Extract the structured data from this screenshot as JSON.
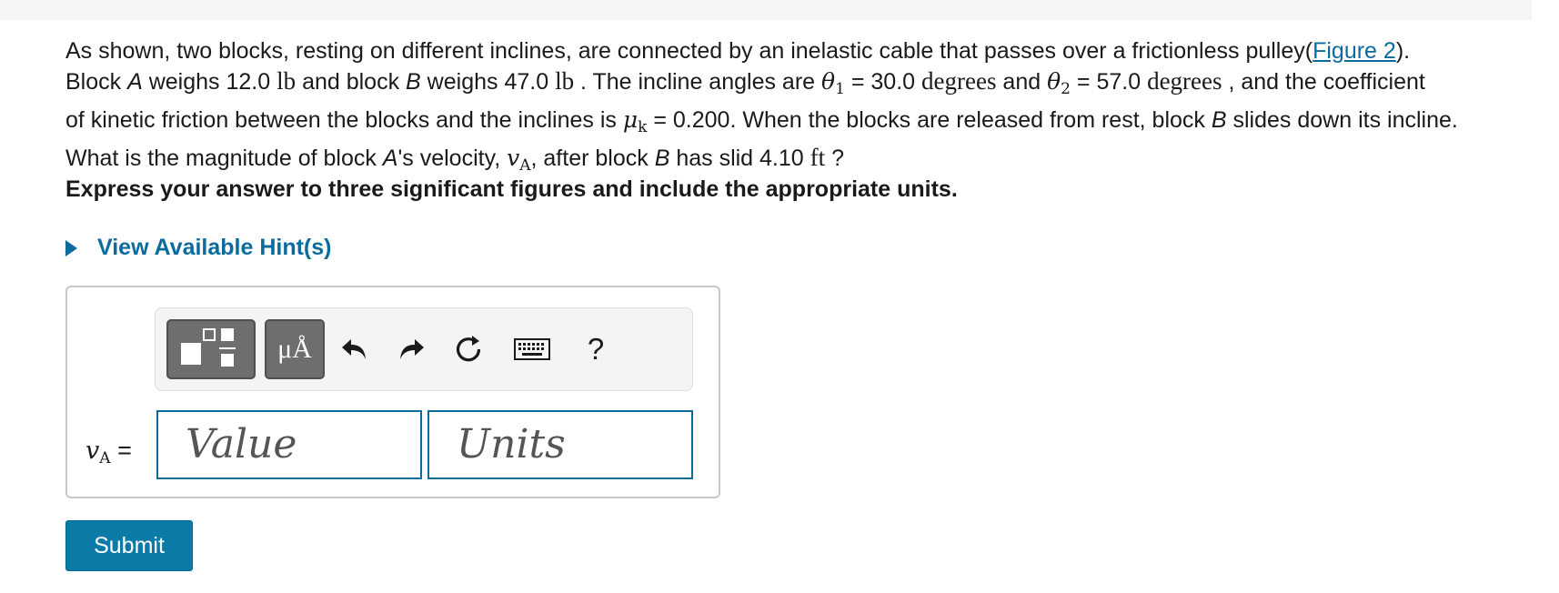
{
  "problem": {
    "line1": {
      "text": "As shown, two blocks, resting on different inclines, are connected by an inelastic cable that passes over a frictionless pulley(",
      "figure_link": "Figure 2",
      "after_link": ")."
    },
    "line2": {
      "t1": "Block ",
      "blockA": "A",
      "t2": " weighs 12.0 ",
      "unit_lb1": "lb",
      "t3": " and block ",
      "blockB": "B",
      "t4": " weighs 47.0 ",
      "unit_lb2": "lb",
      "t5": " . The incline angles are ",
      "theta1": "θ",
      "theta1_sub": "1",
      "t6": " = 30.0 ",
      "unit_deg1": "degrees",
      "t7": " and ",
      "theta2": "θ",
      "theta2_sub": "2",
      "t8": " = 57.0 ",
      "unit_deg2": "degrees",
      "t9": " , and the coefficient"
    },
    "line3": {
      "t1": "of kinetic friction between the blocks and the inclines is ",
      "mu": "μ",
      "mu_sub": "k",
      "t2": " = 0.200. When the blocks are released from rest, block ",
      "blockB": "B",
      "t3": " slides down its incline."
    },
    "line4": {
      "t1": "What is the magnitude of block ",
      "blockA": "A",
      "t2": "'s velocity, ",
      "v": "v",
      "v_sub": "A",
      "t3": ", after block ",
      "blockB": "B",
      "t4": " has slid 4.10 ",
      "unit_ft": "ft",
      "t5": " ?"
    }
  },
  "instructions": "Express your answer to three significant figures and include the appropriate units.",
  "hint": {
    "label": "View Available Hint(s)",
    "icon": "triangle-right-icon"
  },
  "toolbar": {
    "template_button_icon": "fraction-template-icon",
    "units_button_label": "μÅ",
    "undo_icon": "undo-icon",
    "redo_icon": "redo-icon",
    "reset_icon": "reset-icon",
    "keyboard_icon": "keyboard-icon",
    "help_label": "?"
  },
  "answer": {
    "variable": "v",
    "variable_sub": "A",
    "equals": "=",
    "value_placeholder": "Value",
    "units_placeholder": "Units"
  },
  "submit_label": "Submit",
  "colors": {
    "link": "#0b6b9e",
    "submit_bg": "#0b7aa6",
    "toolbar_btn": "#6e6e6e",
    "field_border": "#0b6b9e"
  }
}
